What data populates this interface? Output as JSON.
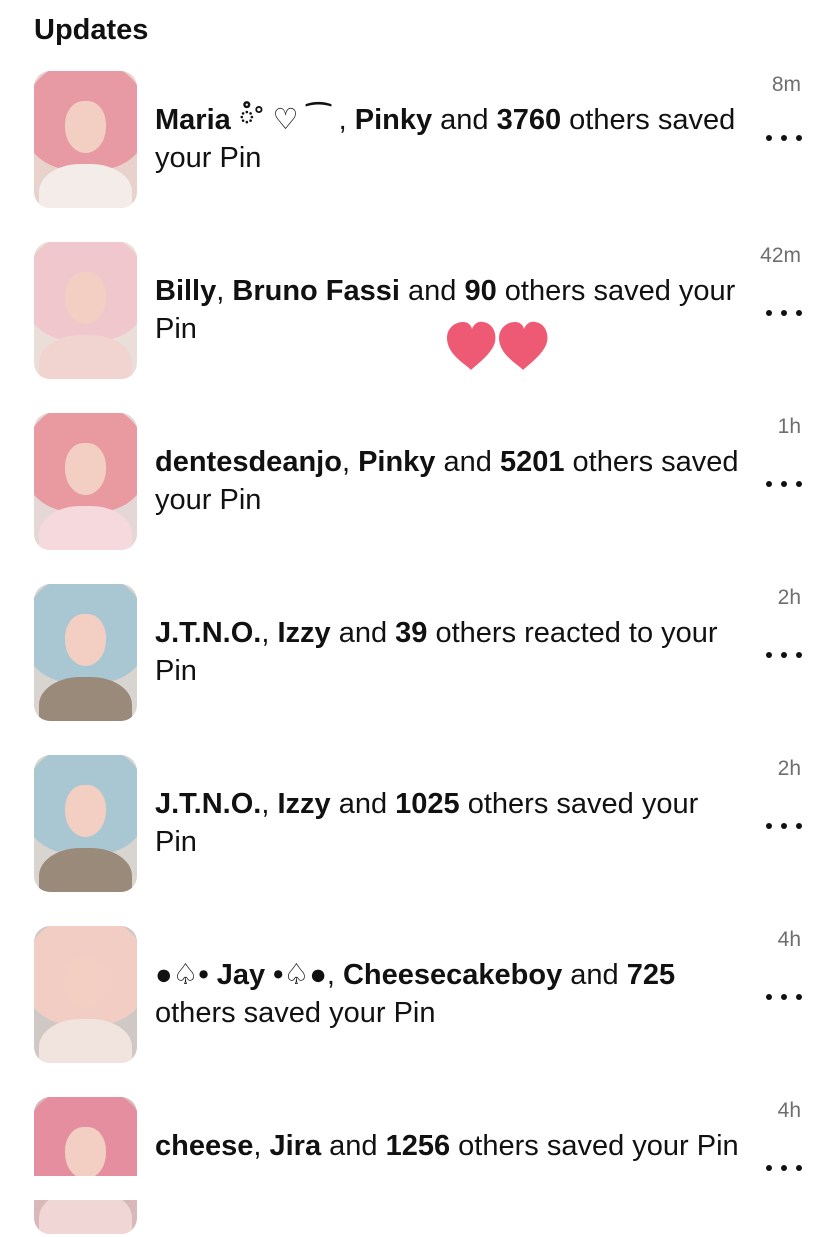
{
  "header": {
    "title": "Updates"
  },
  "action_icon": "more-dots-icon",
  "notifications": [
    {
      "time": "8m",
      "parts": [
        {
          "t": "Maria ཾ˚ ♡ ⁀ ",
          "b": true
        },
        {
          "t": ", ",
          "b": false
        },
        {
          "t": "Pinky",
          "b": true
        },
        {
          "t": " and ",
          "b": false
        },
        {
          "t": "3760",
          "b": true
        },
        {
          "t": " others saved your Pin",
          "b": false
        }
      ],
      "thumb_colors": {
        "bg": "#e9d2cc",
        "hair": "#e79aa3",
        "body": "#f3ece9"
      }
    },
    {
      "time": "42m",
      "parts": [
        {
          "t": "Billy",
          "b": true
        },
        {
          "t": ", ",
          "b": false
        },
        {
          "t": "Bruno Fassi",
          "b": true
        },
        {
          "t": " and ",
          "b": false
        },
        {
          "t": "90",
          "b": true
        },
        {
          "t": " others saved your Pin",
          "b": false
        }
      ],
      "thumb_colors": {
        "bg": "#eadfd8",
        "hair": "#f0c7cc",
        "body": "#f1d3cf"
      }
    },
    {
      "time": "1h",
      "parts": [
        {
          "t": "dentesdeanjo",
          "b": true
        },
        {
          "t": ", ",
          "b": false
        },
        {
          "t": "Pinky",
          "b": true
        },
        {
          "t": " and ",
          "b": false
        },
        {
          "t": "5201",
          "b": true
        },
        {
          "t": " others saved your Pin",
          "b": false
        }
      ],
      "thumb_colors": {
        "bg": "#e4d7d6",
        "hair": "#e99aa0",
        "body": "#f5d9dd"
      }
    },
    {
      "time": "2h",
      "parts": [
        {
          "t": "J.T.N.O.",
          "b": true
        },
        {
          "t": ", ",
          "b": false
        },
        {
          "t": "Izzy",
          "b": true
        },
        {
          "t": " and ",
          "b": false
        },
        {
          "t": "39",
          "b": true
        },
        {
          "t": " others reacted to your Pin",
          "b": false
        }
      ],
      "thumb_colors": {
        "bg": "#d8d4cf",
        "hair": "#a9c7d2",
        "body": "#9a8a7a"
      }
    },
    {
      "time": "2h",
      "parts": [
        {
          "t": "J.T.N.O.",
          "b": true
        },
        {
          "t": ", ",
          "b": false
        },
        {
          "t": "Izzy",
          "b": true
        },
        {
          "t": " and ",
          "b": false
        },
        {
          "t": "1025",
          "b": true
        },
        {
          "t": " others saved your Pin",
          "b": false
        }
      ],
      "thumb_colors": {
        "bg": "#d8d4cf",
        "hair": "#a9c7d2",
        "body": "#9a8a7a"
      }
    },
    {
      "time": "4h",
      "parts": [
        {
          "t": "●♤• Jay •♤●",
          "b": true
        },
        {
          "t": ", ",
          "b": false
        },
        {
          "t": "Cheesecakeboy",
          "b": true
        },
        {
          "t": " and ",
          "b": false
        },
        {
          "t": "725",
          "b": true
        },
        {
          "t": " others saved your Pin",
          "b": false
        }
      ],
      "thumb_colors": {
        "bg": "#cfc8c4",
        "hair": "#f2cdc4",
        "body": "#f1e4de"
      }
    },
    {
      "time": "4h",
      "parts": [
        {
          "t": "cheese",
          "b": true
        },
        {
          "t": ", ",
          "b": false
        },
        {
          "t": "Jira",
          "b": true
        },
        {
          "t": " and ",
          "b": false
        },
        {
          "t": "1256",
          "b": true
        },
        {
          "t": " others saved your Pin",
          "b": false
        }
      ],
      "thumb_colors": {
        "bg": "#d9b8b9",
        "hair": "#e58ea0",
        "body": "#f0d6d4"
      }
    }
  ],
  "overlay": {
    "icon": "hearts-sticker-icon",
    "color": "#ee5a73"
  }
}
